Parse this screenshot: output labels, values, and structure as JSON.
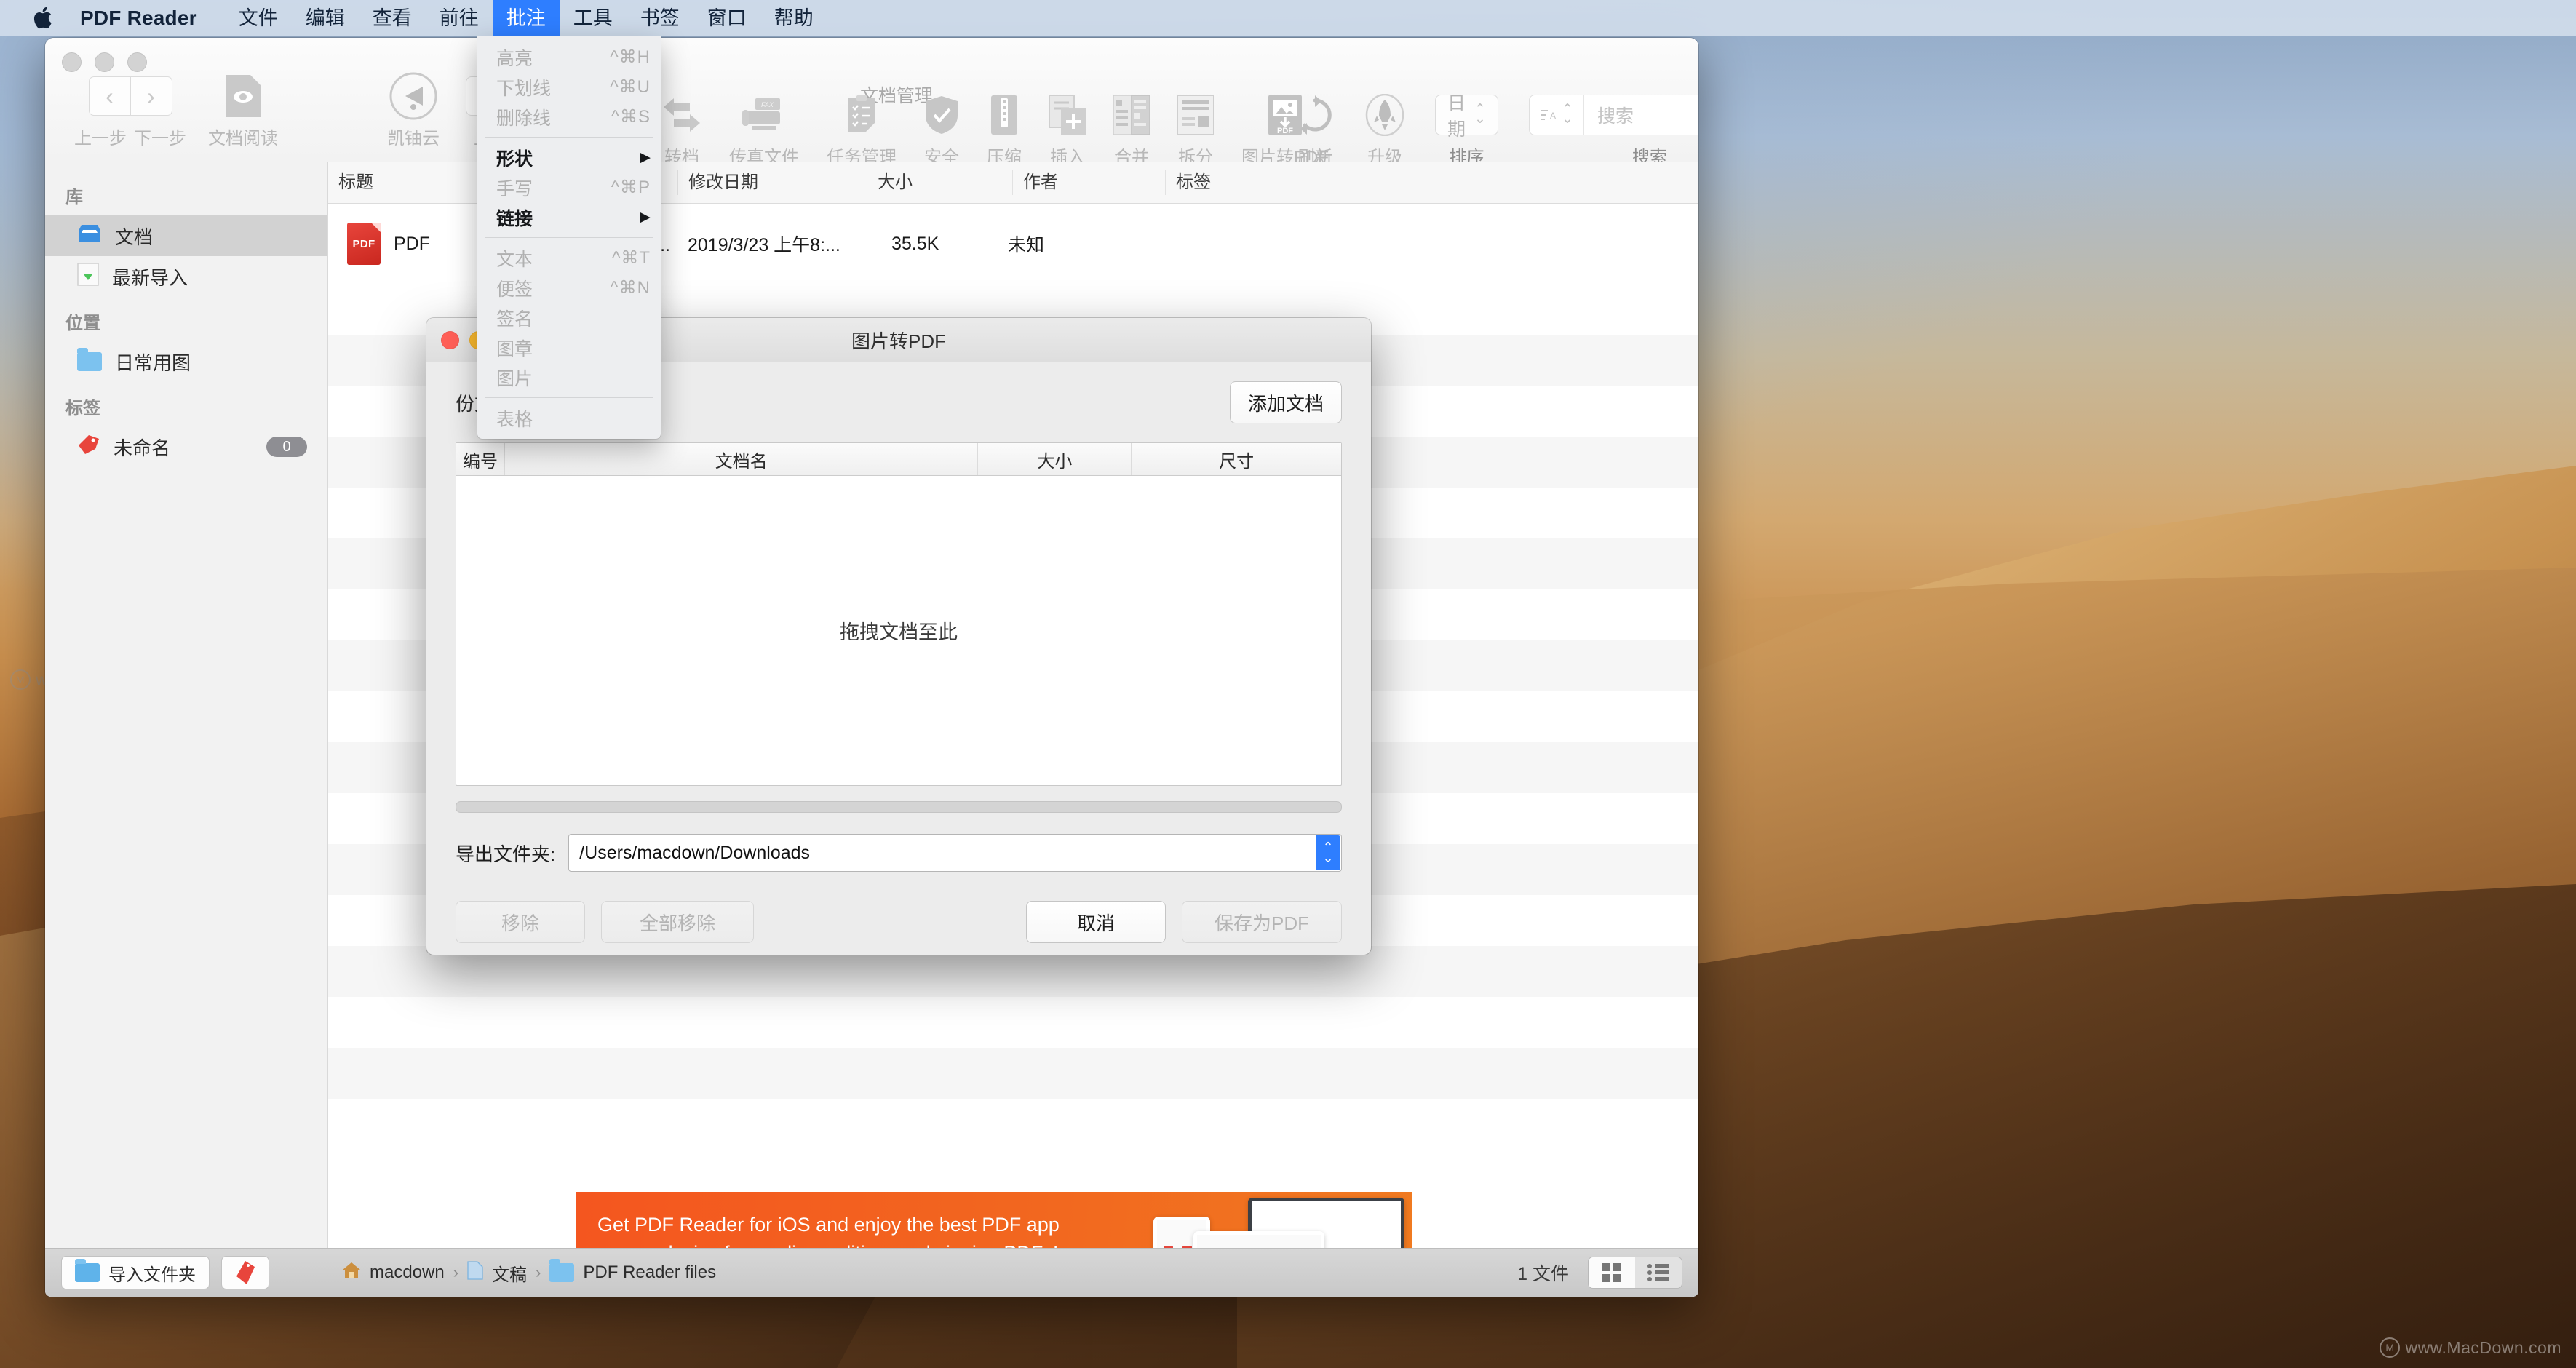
{
  "menubar": {
    "apple_icon": "apple-logo-icon",
    "app_name": "PDF Reader",
    "items": [
      {
        "label": "文件",
        "active": false
      },
      {
        "label": "编辑",
        "active": false
      },
      {
        "label": "查看",
        "active": false
      },
      {
        "label": "前往",
        "active": false
      },
      {
        "label": "批注",
        "active": true
      },
      {
        "label": "工具",
        "active": false
      },
      {
        "label": "书签",
        "active": false
      },
      {
        "label": "窗口",
        "active": false
      },
      {
        "label": "帮助",
        "active": false
      }
    ]
  },
  "dropdown": {
    "groups": [
      [
        {
          "label": "高亮",
          "shortcut": "^⌘H",
          "enabled": false,
          "submenu": false
        },
        {
          "label": "下划线",
          "shortcut": "^⌘U",
          "enabled": false,
          "submenu": false
        },
        {
          "label": "删除线",
          "shortcut": "^⌘S",
          "enabled": false,
          "submenu": false
        }
      ],
      [
        {
          "label": "形状",
          "shortcut": "",
          "enabled": true,
          "submenu": true
        },
        {
          "label": "手写",
          "shortcut": "^⌘P",
          "enabled": false,
          "submenu": false
        },
        {
          "label": "链接",
          "shortcut": "",
          "enabled": true,
          "submenu": true
        }
      ],
      [
        {
          "label": "文本",
          "shortcut": "^⌘T",
          "enabled": false,
          "submenu": false
        },
        {
          "label": "便签",
          "shortcut": "^⌘N",
          "enabled": false,
          "submenu": false
        },
        {
          "label": "签名",
          "shortcut": "",
          "enabled": false,
          "submenu": false
        },
        {
          "label": "图章",
          "shortcut": "",
          "enabled": false,
          "submenu": false
        },
        {
          "label": "图片",
          "shortcut": "",
          "enabled": false,
          "submenu": false
        }
      ],
      [
        {
          "label": "表格",
          "shortcut": "",
          "enabled": false,
          "submenu": false
        }
      ]
    ]
  },
  "toolbar": {
    "section_title": "文档管理",
    "back_label": "上一步",
    "forward_label": "下一步",
    "reader_label": "文档阅读",
    "cloud_label": "凯铀云",
    "upload_label": "上传",
    "items": [
      {
        "label": "转档",
        "icon": "convert-icon"
      },
      {
        "label": "传真文件",
        "icon": "fax-icon"
      },
      {
        "label": "任务管理",
        "icon": "clipboard-icon"
      },
      {
        "label": "安全",
        "icon": "shield-icon"
      },
      {
        "label": "压缩",
        "icon": "compress-icon"
      },
      {
        "label": "插入",
        "icon": "insert-icon"
      },
      {
        "label": "合并",
        "icon": "merge-icon"
      },
      {
        "label": "拆分",
        "icon": "split-icon"
      },
      {
        "label": "图片转PDF",
        "icon": "image-to-pdf-icon"
      }
    ],
    "refresh_label": "刷新",
    "upgrade_label": "升级",
    "sort_label": "排序",
    "sort_value": "日期",
    "search_label": "搜索",
    "search_placeholder": "搜索"
  },
  "sidebar": {
    "sections": [
      {
        "header": "库",
        "items": [
          {
            "label": "文档",
            "icon": "inbox-icon",
            "selected": true,
            "badge": ""
          },
          {
            "label": "最新导入",
            "icon": "download-icon",
            "selected": false,
            "badge": ""
          }
        ]
      },
      {
        "header": "位置",
        "items": [
          {
            "label": "日常用图",
            "icon": "folder-icon",
            "selected": false,
            "badge": ""
          }
        ]
      },
      {
        "header": "标签",
        "items": [
          {
            "label": "未命名",
            "icon": "tag-icon",
            "selected": false,
            "badge": "0"
          }
        ]
      }
    ]
  },
  "filelist": {
    "columns": [
      "标题",
      "修改日期",
      "大小",
      "作者",
      "标签"
    ],
    "sort_indicator": "^",
    "rows": [
      {
        "icon": "pdf-file-icon",
        "title": "PDF",
        "title_tail": "注...",
        "date": "2019/3/23 上午8:...",
        "size": "35.5K",
        "author": "未知",
        "tag": ""
      }
    ]
  },
  "banner": {
    "line1": "Get PDF Reader for iOS and enjoy the best PDF app",
    "line2": "on any device for reading, editing, and signing PDFs!",
    "color": "#f4561f"
  },
  "statusbar": {
    "import_label": "导入文件夹",
    "tag_icon": "tag-icon",
    "breadcrumbs": [
      "macdown",
      "文稿",
      "PDF Reader files"
    ],
    "separator": "›",
    "file_count": "1 文件",
    "grid_view_icon": "grid-view-icon",
    "list_view_icon": "list-view-icon",
    "active_view": "grid"
  },
  "dialog": {
    "title": "图片转PDF",
    "count_label": "份文档",
    "add_button": "添加文档",
    "table_columns": [
      "编号",
      "文档名",
      "大小",
      "尺寸"
    ],
    "drop_hint": "拖拽文档至此",
    "export_label": "导出文件夹:",
    "export_path": "/Users/macdown/Downloads",
    "buttons": {
      "remove": "移除",
      "remove_all": "全部移除",
      "cancel": "取消",
      "save_pdf": "保存为PDF"
    }
  },
  "watermark": {
    "text": "www.MacDown.com",
    "mark": "M"
  }
}
